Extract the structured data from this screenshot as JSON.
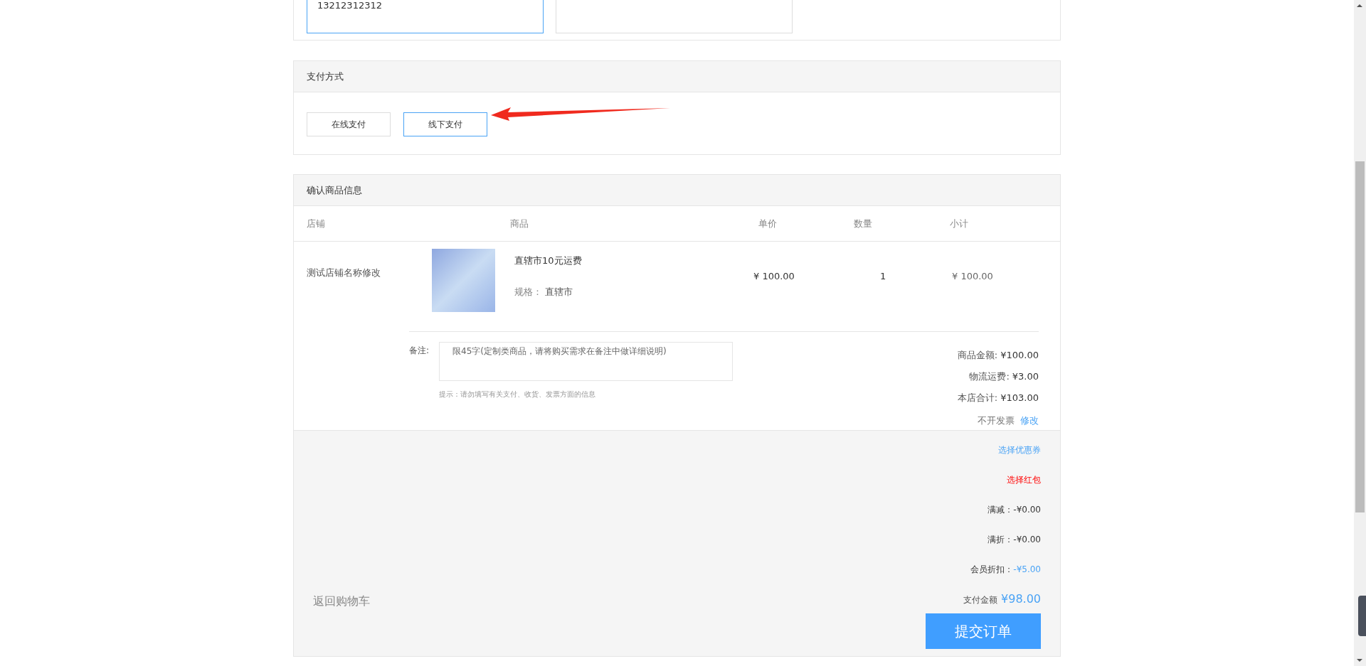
{
  "address": {
    "cards": [
      {
        "text": "13212312312",
        "selected": true
      },
      {
        "selected": false
      }
    ]
  },
  "payment": {
    "title": "支付方式",
    "options": [
      {
        "label": "在线支付",
        "selected": false
      },
      {
        "label": "线下支付",
        "selected": true
      }
    ]
  },
  "goods": {
    "title": "确认商品信息",
    "columns": [
      "店铺",
      "商品",
      "单价",
      "数量",
      "小计"
    ],
    "rows": [
      {
        "store": "测试店铺名称修改",
        "product": "直辖市10元运费",
        "spec_label": "规格：",
        "spec": "直辖市",
        "price": "¥ 100.00",
        "quantity": "1",
        "subtotal": "¥ 100.00"
      }
    ],
    "note": {
      "label": "备注:",
      "placeholder": "限45字(定制类商品，请将购买需求在备注中做详细说明)",
      "hint": "提示：请勿填写有关支付、收货、发票方面的信息"
    },
    "summary": [
      {
        "label": "商品金额:",
        "value": "¥100.00"
      },
      {
        "label": "物流运费:",
        "value": "¥3.00"
      },
      {
        "label": "本店合计:",
        "value": "¥103.00"
      }
    ],
    "invoice": {
      "text": "不开发票",
      "link": "修改"
    }
  },
  "footer": {
    "links": [
      {
        "text": "选择优惠券",
        "kind": "coupon"
      },
      {
        "text": "选择红包",
        "kind": "redpacket"
      }
    ],
    "discounts": [
      {
        "label": "满减：",
        "value": "-¥0.00",
        "kind": "plain"
      },
      {
        "label": "满折：",
        "value": "-¥0.00",
        "kind": "plain"
      },
      {
        "label": "会员折扣：",
        "value": "-¥5.00",
        "kind": "accent"
      }
    ],
    "total_label": "支付金额",
    "total": "¥98.00",
    "submit": "提交订单",
    "back": "返回购物车"
  }
}
